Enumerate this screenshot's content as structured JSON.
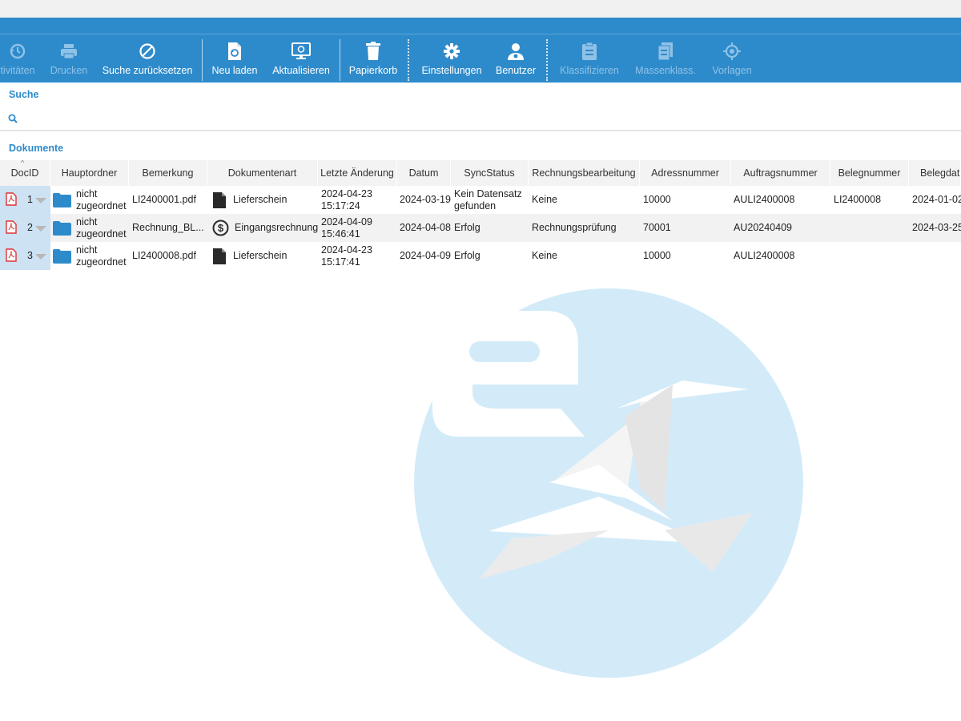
{
  "toolbar": {
    "buttons": [
      {
        "label": "tivitäten",
        "icon": "history-icon",
        "disabled": true
      },
      {
        "label": "Drucken",
        "icon": "printer-icon",
        "disabled": true
      },
      {
        "label": "Suche zurücksetzen",
        "icon": "reset-search-icon",
        "disabled": false
      },
      {
        "label": "Neu laden",
        "icon": "reload-document-icon",
        "disabled": false
      },
      {
        "label": "Aktualisieren",
        "icon": "refresh-monitor-icon",
        "disabled": false
      },
      {
        "label": "Papierkorb",
        "icon": "trash-icon",
        "disabled": false
      },
      {
        "label": "Einstellungen",
        "icon": "gear-icon",
        "disabled": false
      },
      {
        "label": "Benutzer",
        "icon": "user-icon",
        "disabled": false
      },
      {
        "label": "Klassifizieren",
        "icon": "clipboard-icon",
        "disabled": true
      },
      {
        "label": "Massenklass.",
        "icon": "stack-icon",
        "disabled": true
      },
      {
        "label": "Vorlagen",
        "icon": "target-icon",
        "disabled": true
      }
    ]
  },
  "search": {
    "title": "Suche"
  },
  "documents": {
    "title": "Dokumente",
    "columns": [
      "DocID",
      "Hauptordner",
      "Bemerkung",
      "Dokumentenart",
      "Letzte Änderung",
      "Datum",
      "SyncStatus",
      "Rechnungsbearbeitung",
      "Adressnummer",
      "Auftragsnummer",
      "Belegnummer",
      "Belegdat"
    ],
    "rows": [
      {
        "id": "1",
        "folder": "nicht zugeordnet",
        "remark": "LI2400001.pdf",
        "doctype": "Lieferschein",
        "doctype_icon": "document-icon",
        "changed": "2024-04-23 15:17:24",
        "date": "2024-03-19",
        "sync": "Kein Datensatz gefunden",
        "invoice": "Keine",
        "address": "10000",
        "order": "AULI2400008",
        "receipt": "LI2400008",
        "receipt_date": "2024-01-02"
      },
      {
        "id": "2",
        "folder": "nicht zugeordnet",
        "remark": "Rechnung_BL...",
        "doctype": "Eingangsrechnung",
        "doctype_icon": "dollar-icon",
        "changed": "2024-04-09 15:46:41",
        "date": "2024-04-08",
        "sync": "Erfolg",
        "invoice": "Rechnungsprüfung",
        "address": "70001",
        "order": "AU20240409",
        "receipt": "",
        "receipt_date": "2024-03-25"
      },
      {
        "id": "3",
        "folder": "nicht zugeordnet",
        "remark": "LI2400008.pdf",
        "doctype": "Lieferschein",
        "doctype_icon": "document-icon",
        "changed": "2024-04-23 15:17:41",
        "date": "2024-04-09",
        "sync": "Erfolg",
        "invoice": "Keine",
        "address": "10000",
        "order": "AULI2400008",
        "receipt": "",
        "receipt_date": ""
      }
    ]
  },
  "colors": {
    "accent": "#2e8bcb",
    "watermark": "#d3ebf9",
    "selection": "#cde2f3"
  }
}
